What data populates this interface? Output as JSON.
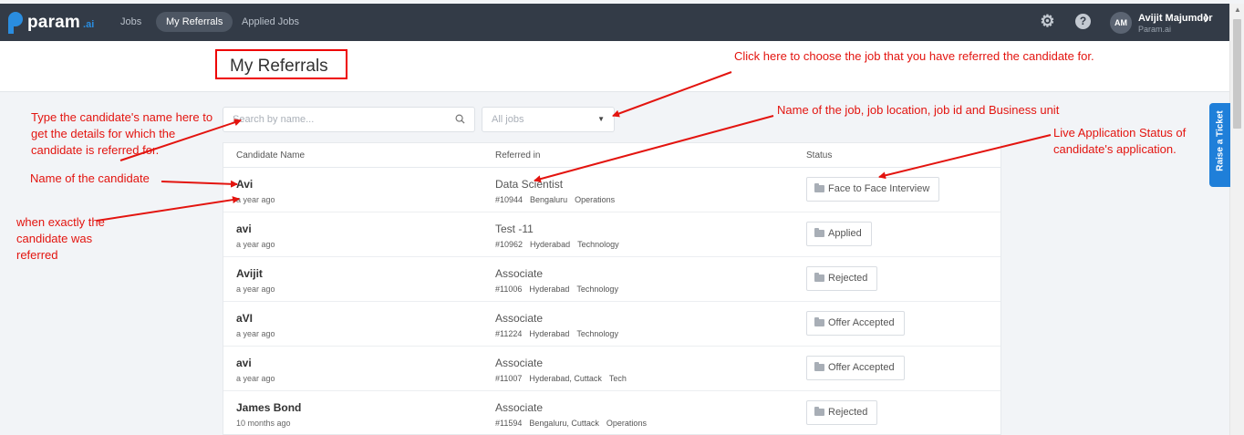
{
  "app": {
    "logo": "param",
    "logo_suffix": ".ai"
  },
  "nav": {
    "items": [
      {
        "label": "Jobs"
      },
      {
        "label": "My Referrals"
      },
      {
        "label": "Applied Jobs"
      }
    ]
  },
  "user": {
    "initials": "AM",
    "name": "Avijit Majumder",
    "org": "Param.ai"
  },
  "page": {
    "title": "My Referrals"
  },
  "filters": {
    "search_placeholder": "Search by name...",
    "jobs_select_value": "All jobs"
  },
  "table": {
    "headers": {
      "candidate": "Candidate Name",
      "referred": "Referred in",
      "status": "Status"
    },
    "rows": [
      {
        "name": "Avi",
        "time": "a year ago",
        "job": "Data Scientist",
        "id": "#10944",
        "location": "Bengaluru",
        "unit": "Operations",
        "status": "Face to Face Interview"
      },
      {
        "name": "avi",
        "time": "a year ago",
        "job": "Test -11",
        "id": "#10962",
        "location": "Hyderabad",
        "unit": "Technology",
        "status": "Applied"
      },
      {
        "name": "Avijit",
        "time": "a year ago",
        "job": "Associate",
        "id": "#11006",
        "location": "Hyderabad",
        "unit": "Technology",
        "status": "Rejected"
      },
      {
        "name": "aVI",
        "time": "a year ago",
        "job": "Associate",
        "id": "#11224",
        "location": "Hyderabad",
        "unit": "Technology",
        "status": "Offer Accepted"
      },
      {
        "name": "avi",
        "time": "a year ago",
        "job": "Associate",
        "id": "#11007",
        "location": "Hyderabad, Cuttack",
        "unit": "Tech",
        "status": "Offer Accepted"
      },
      {
        "name": "James Bond",
        "time": "10 months ago",
        "job": "Associate",
        "id": "#11594",
        "location": "Bengaluru, Cuttack",
        "unit": "Operations",
        "status": "Rejected"
      }
    ]
  },
  "ticket": {
    "label": "Raise a Ticket"
  },
  "annotations": {
    "search": "Type the candidate's name here to get the details for which the candidate is referred for.",
    "job_select": "Click here to choose the job that you have referred the candidate for.",
    "job_name": "Name of the job, job location, job id and Business unit",
    "status": "Live Application Status of candidate's application.",
    "candidate": "Name of the candidate",
    "time": "when exactly the candidate was referred"
  },
  "colors": {
    "nav_bg": "#333b47",
    "accent": "#1f7fd9",
    "annotation": "#e3140f"
  }
}
